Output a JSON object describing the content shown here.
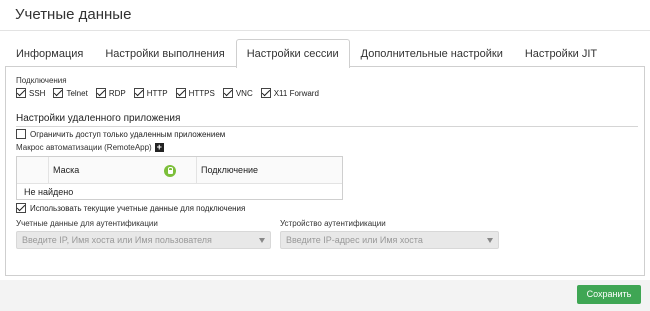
{
  "header": {
    "title": "Учетные данные"
  },
  "tabs": [
    {
      "label": "Информация"
    },
    {
      "label": "Настройки выполнения"
    },
    {
      "label": "Настройки сессии"
    },
    {
      "label": "Дополнительные настройки"
    },
    {
      "label": "Настройки JIT"
    }
  ],
  "active_tab": "Настройки сессии",
  "connections": {
    "label": "Подключения",
    "items": [
      {
        "label": "SSH",
        "checked": true
      },
      {
        "label": "Telnet",
        "checked": true
      },
      {
        "label": "RDP",
        "checked": true
      },
      {
        "label": "HTTP",
        "checked": true
      },
      {
        "label": "HTTPS",
        "checked": true
      },
      {
        "label": "VNC",
        "checked": true
      },
      {
        "label": "X11 Forward",
        "checked": true
      }
    ]
  },
  "remote_app": {
    "section_title": "Настройки удаленного приложения",
    "restrict_label": "Ограничить доступ только удаленным приложением",
    "restrict_checked": false,
    "macro_label": "Макрос автоматизации (RemoteApp)",
    "table": {
      "columns": [
        "Маска",
        "Подключение"
      ],
      "empty_text": "Не найдено"
    },
    "use_current_label": "Использовать текущие учетные данные для подключения",
    "use_current_checked": true
  },
  "auth": {
    "credentials_label": "Учетные данные для аутентификации",
    "credentials_placeholder": "Введите IP, Имя хоста или Имя пользователя",
    "device_label": "Устройство аутентификации",
    "device_placeholder": "Введите IP-адрес или Имя хоста"
  },
  "footer": {
    "save_label": "Сохранить"
  },
  "colors": {
    "accent": "#3fa654",
    "lock_icon": "#7cbf3a"
  }
}
